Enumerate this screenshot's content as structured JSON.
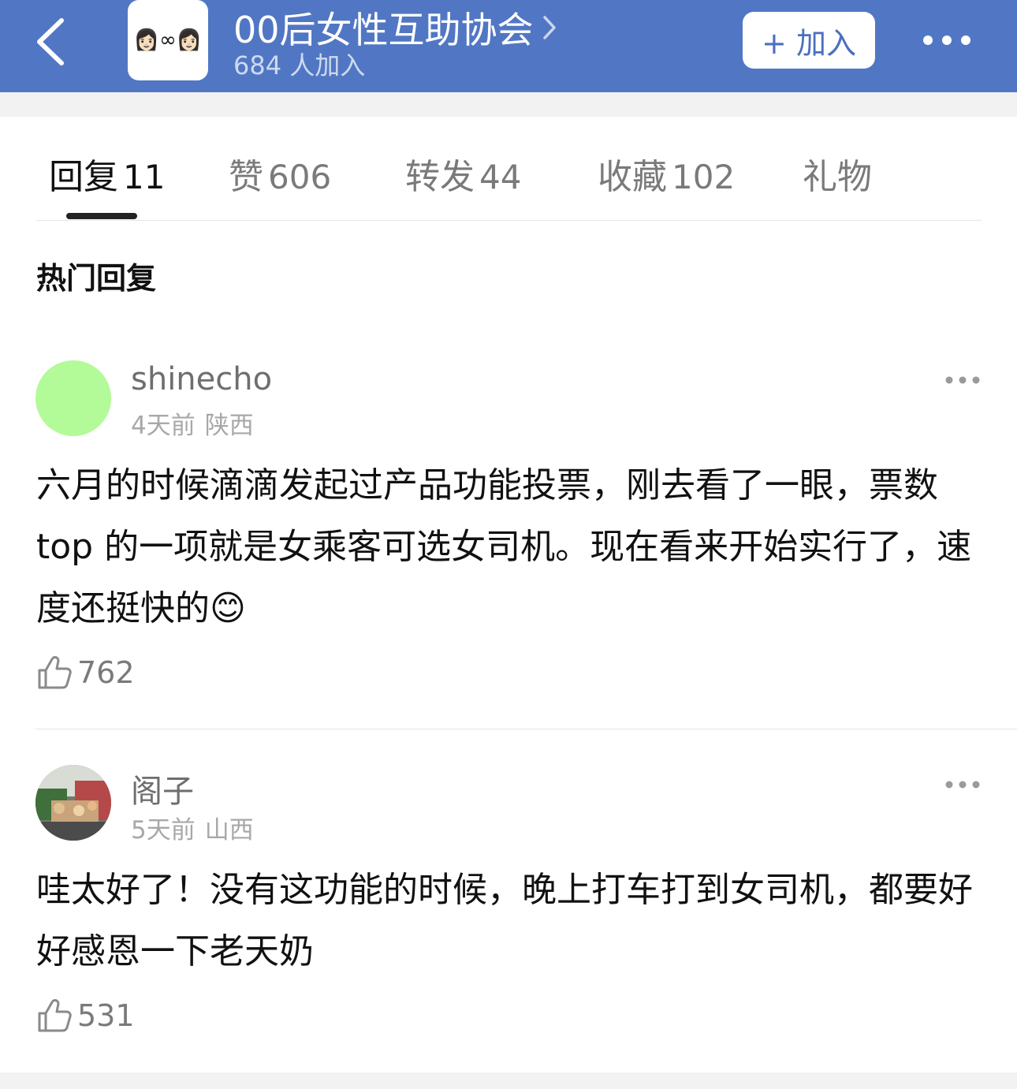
{
  "header": {
    "group_name": "00后女性互助协会",
    "member_count": "684 人加入",
    "join_label": "+ 加入",
    "bg_color": "#5177c4"
  },
  "tabs": [
    {
      "label": "回复",
      "count": "11",
      "active": true
    },
    {
      "label": "赞",
      "count": "606"
    },
    {
      "label": "转发",
      "count": "44"
    },
    {
      "label": "收藏",
      "count": "102"
    },
    {
      "label": "礼物",
      "count": ""
    }
  ],
  "section_title": "热门回复",
  "comments": [
    {
      "username": "shinecho",
      "time": "4天前",
      "location": "陕西",
      "text": "六月的时候滴滴发起过产品功能投票，刚去看了一眼，票数 top 的一项就是女乘客可选女司机。现在看来开始实行了，速度还挺快的😊",
      "likes": "762",
      "avatar_color": "#b3fa99"
    },
    {
      "username": "阁子",
      "time": "5天前",
      "location": "山西",
      "text": "哇太好了！没有这功能的时候，晚上打车打到女司机，都要好好感恩一下老天奶",
      "likes": "531"
    }
  ],
  "icons": {
    "back": "chevron-left-icon",
    "more": "ellipsis-icon",
    "like": "thumbs-up-icon",
    "logo_emoji": "👩🏻∞👩🏻"
  }
}
